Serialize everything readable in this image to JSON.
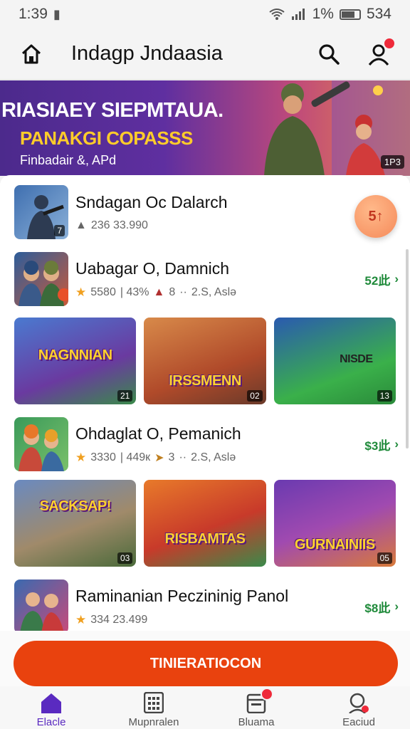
{
  "status_bar": {
    "time": "1:39",
    "battery": "1%",
    "clock2": "534"
  },
  "app_bar": {
    "title": "Indagp Jndaasia"
  },
  "banner": {
    "title": "RIASIAEY SIEPMTAUA.",
    "subtitle": "PANAKGI COPASSS",
    "caption": "Finbadair &, APd",
    "badge": "1P3"
  },
  "list": [
    {
      "title": "Sndagan Oc Dalarch",
      "meta": "236 33.990",
      "badge": "7",
      "action": "5↑"
    },
    {
      "title": "Uabagar O, Damnich",
      "rating": "5580",
      "meta1": "| 43%",
      "meta2": "8",
      "meta3": "2.S, Aslə",
      "price": "52此"
    },
    {
      "title": "Ohdaglat O, Pemanich",
      "rating": "3330",
      "meta1": "| 449к",
      "meta2": "3",
      "meta3": "2.S, Aslə",
      "price": "$3此"
    },
    {
      "title": "Raminanian Peczininig Panol",
      "rating": "334 23.499",
      "price": "$8此"
    }
  ],
  "tiles_row1": [
    {
      "label": "NAGNNIAN",
      "num": "21"
    },
    {
      "label": "IRSSMENN",
      "num": "02"
    },
    {
      "label": "NISDE",
      "num": "13"
    }
  ],
  "tiles_row2": [
    {
      "label": "SACKSAP!",
      "num": "03"
    },
    {
      "label": "RISBAMTAS",
      "num": ""
    },
    {
      "label": "GURNAINIIS",
      "num": "05"
    }
  ],
  "cta": {
    "label": "TINIERATIOCON"
  },
  "bottom_nav": [
    {
      "label": "Elacle",
      "icon": "home-icon",
      "active": true
    },
    {
      "label": "Mupnralen",
      "icon": "grid-icon",
      "active": false
    },
    {
      "label": "Bluama",
      "icon": "calendar-icon",
      "active": false
    },
    {
      "label": "Eaciud",
      "icon": "profile-icon",
      "active": false
    }
  ],
  "colors": {
    "accent": "#e9420e",
    "brand": "#5a2ac0",
    "price": "#1f8a3a"
  }
}
